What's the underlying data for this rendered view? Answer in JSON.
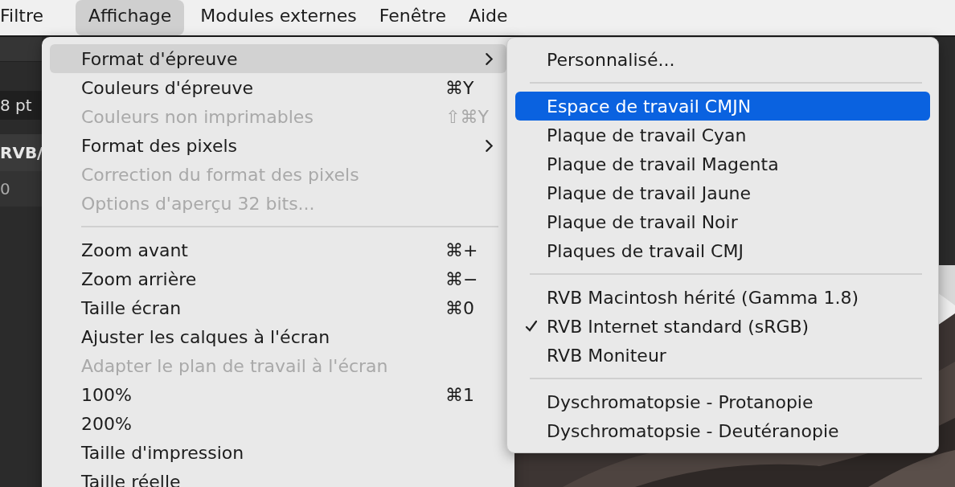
{
  "menubar": [
    {
      "label": "Filtre",
      "selected": false
    },
    {
      "label": "Affichage",
      "selected": true
    },
    {
      "label": "Modules externes",
      "selected": false
    },
    {
      "label": "Fenêtre",
      "selected": false
    },
    {
      "label": "Aide",
      "selected": false
    }
  ],
  "toolbar": {
    "size_field": "8 pt",
    "document_tab": "RVB/",
    "ruler_mark": "0"
  },
  "menu": [
    {
      "kind": "item",
      "label": "Format d'épreuve",
      "submenu": true,
      "selected": true,
      "disabled": false
    },
    {
      "kind": "item",
      "label": "Couleurs d'épreuve",
      "shortcut": "⌘Y",
      "selected": false,
      "disabled": false
    },
    {
      "kind": "item",
      "label": "Couleurs non imprimables",
      "shortcut": "⇧⌘Y",
      "selected": false,
      "disabled": true
    },
    {
      "kind": "item",
      "label": "Format des pixels",
      "submenu": true,
      "selected": false,
      "disabled": false
    },
    {
      "kind": "item",
      "label": "Correction du format des pixels",
      "selected": false,
      "disabled": true
    },
    {
      "kind": "item",
      "label": "Options d'aperçu 32 bits...",
      "selected": false,
      "disabled": true
    },
    {
      "kind": "separator"
    },
    {
      "kind": "item",
      "label": "Zoom avant",
      "shortcut": "⌘+",
      "selected": false,
      "disabled": false
    },
    {
      "kind": "item",
      "label": "Zoom arrière",
      "shortcut": "⌘−",
      "selected": false,
      "disabled": false
    },
    {
      "kind": "item",
      "label": "Taille écran",
      "shortcut": "⌘0",
      "selected": false,
      "disabled": false
    },
    {
      "kind": "item",
      "label": "Ajuster les calques à l'écran",
      "selected": false,
      "disabled": false
    },
    {
      "kind": "item",
      "label": "Adapter le plan de travail à l'écran",
      "selected": false,
      "disabled": true
    },
    {
      "kind": "item",
      "label": "100%",
      "shortcut": "⌘1",
      "selected": false,
      "disabled": false
    },
    {
      "kind": "item",
      "label": "200%",
      "selected": false,
      "disabled": false
    },
    {
      "kind": "item",
      "label": "Taille d'impression",
      "selected": false,
      "disabled": false
    },
    {
      "kind": "item",
      "label": "Taille réelle",
      "selected": false,
      "disabled": false
    }
  ],
  "submenu": [
    {
      "kind": "item",
      "label": "Personnalisé...",
      "selected": false,
      "checked": false
    },
    {
      "kind": "separator"
    },
    {
      "kind": "item",
      "label": "Espace de travail CMJN",
      "selected": true,
      "checked": false
    },
    {
      "kind": "item",
      "label": "Plaque de travail Cyan",
      "selected": false,
      "checked": false
    },
    {
      "kind": "item",
      "label": "Plaque de travail Magenta",
      "selected": false,
      "checked": false
    },
    {
      "kind": "item",
      "label": "Plaque de travail Jaune",
      "selected": false,
      "checked": false
    },
    {
      "kind": "item",
      "label": "Plaque de travail Noir",
      "selected": false,
      "checked": false
    },
    {
      "kind": "item",
      "label": "Plaques de travail CMJ",
      "selected": false,
      "checked": false
    },
    {
      "kind": "separator"
    },
    {
      "kind": "item",
      "label": "RVB Macintosh hérité (Gamma 1.8)",
      "selected": false,
      "checked": false
    },
    {
      "kind": "item",
      "label": "RVB Internet standard (sRGB)",
      "selected": false,
      "checked": true
    },
    {
      "kind": "item",
      "label": "RVB Moniteur",
      "selected": false,
      "checked": false
    },
    {
      "kind": "separator"
    },
    {
      "kind": "item",
      "label": "Dyschromatopsie - Protanopie",
      "selected": false,
      "checked": false
    },
    {
      "kind": "item",
      "label": "Dyschromatopsie - Deutéranopie",
      "selected": false,
      "checked": false
    }
  ]
}
